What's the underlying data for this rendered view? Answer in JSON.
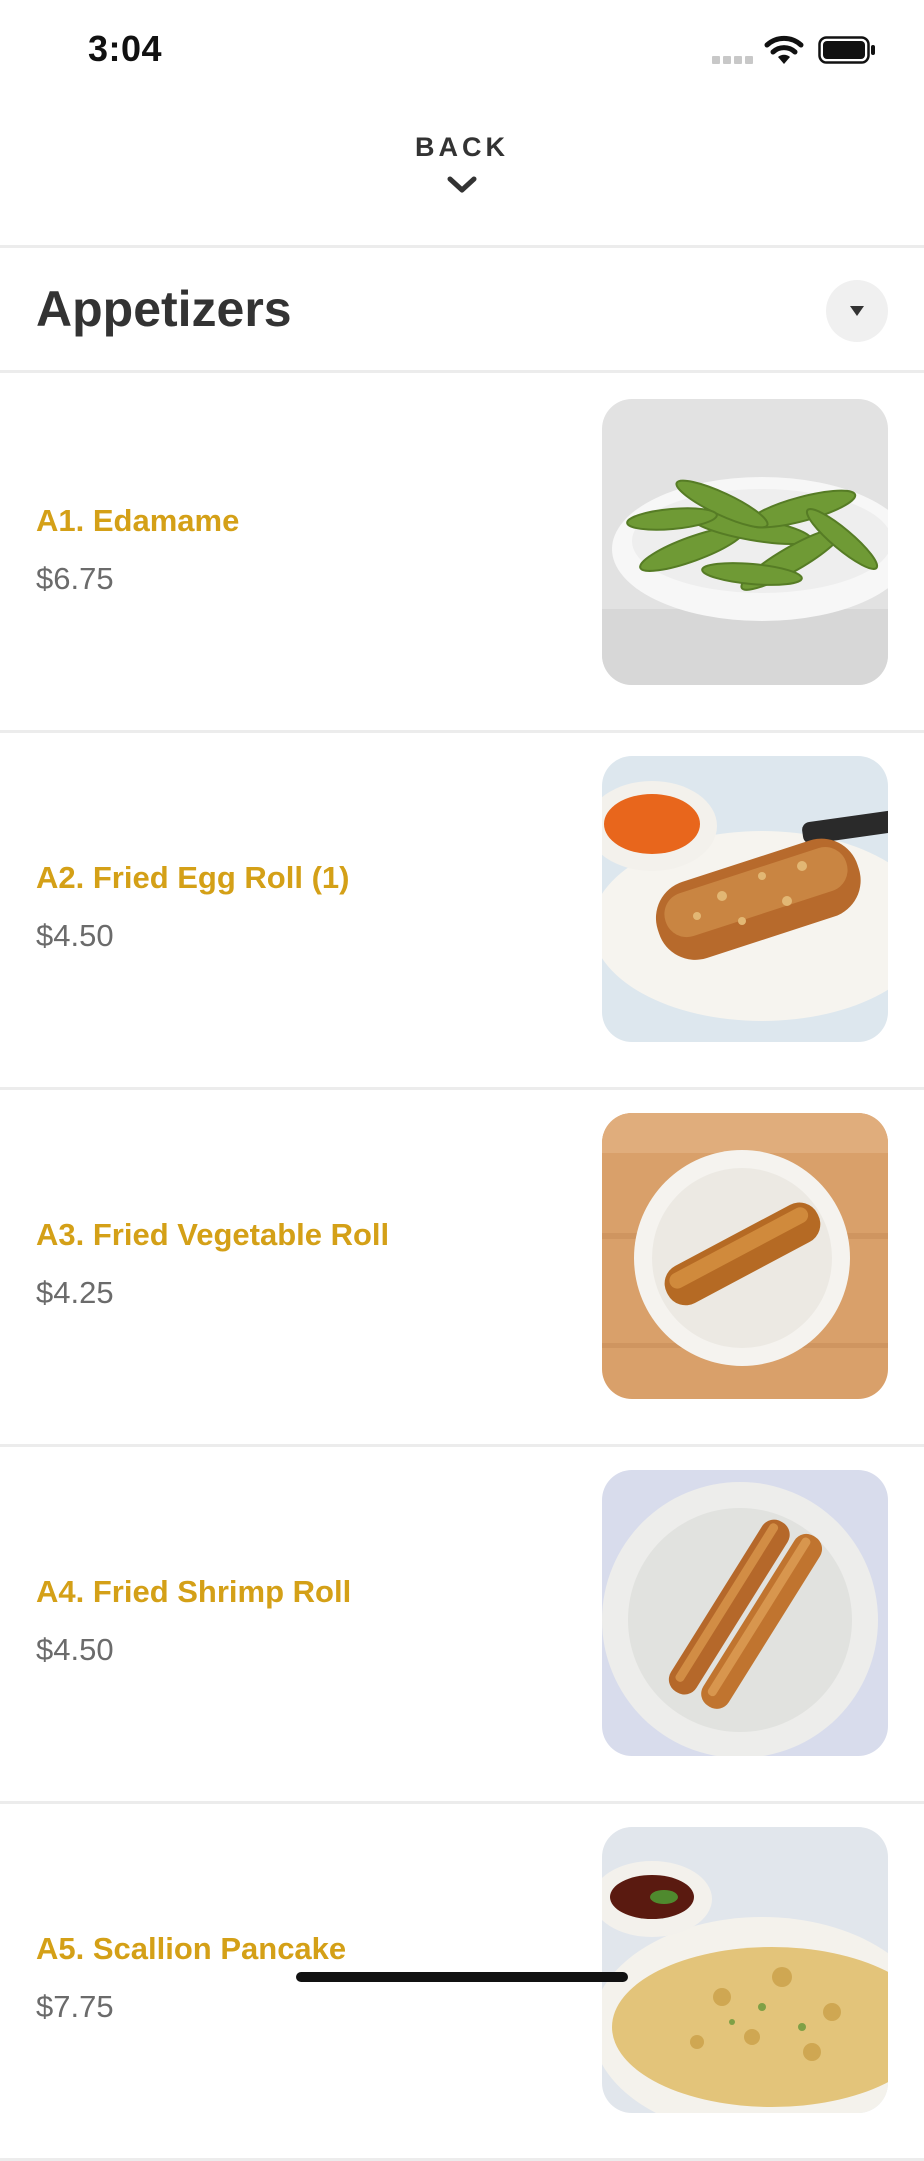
{
  "status_bar": {
    "time": "3:04"
  },
  "nav": {
    "back_label": "BACK"
  },
  "category": {
    "title": "Appetizers"
  },
  "items": [
    {
      "name": "A1. Edamame",
      "price": "$6.75"
    },
    {
      "name": "A2. Fried Egg Roll (1)",
      "price": "$4.50"
    },
    {
      "name": "A3. Fried Vegetable Roll",
      "price": "$4.25"
    },
    {
      "name": "A4. Fried Shrimp Roll",
      "price": "$4.50"
    },
    {
      "name": "A5. Scallion Pancake",
      "price": "$7.75"
    }
  ],
  "colors": {
    "accent": "#d4a017",
    "price": "#6b6b6b",
    "title": "#333333"
  },
  "icons": {
    "status": [
      "signal-icon",
      "wifi-icon",
      "battery-icon"
    ],
    "nav": "chevron-down-icon",
    "dropdown": "caret-down-icon"
  }
}
